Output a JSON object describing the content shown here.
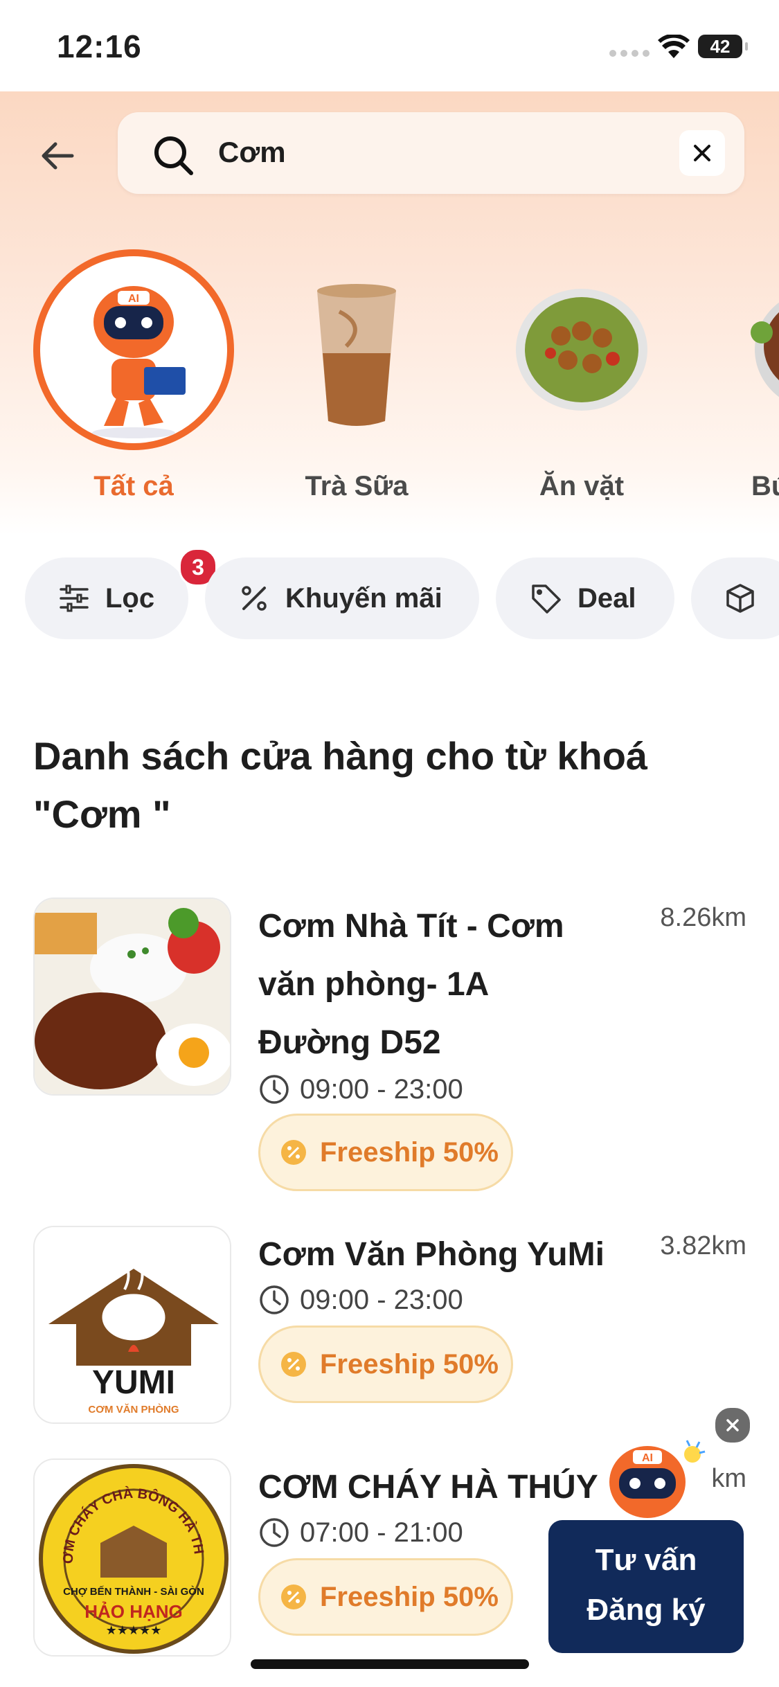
{
  "status_bar": {
    "time": "12:16",
    "battery": "42"
  },
  "search": {
    "query": "Cơm"
  },
  "categories": [
    {
      "label": "Tất cả",
      "icon": "ai-robot-icon",
      "active": true
    },
    {
      "label": "Trà Sữa",
      "icon": "milk-tea-icon",
      "active": false
    },
    {
      "label": "Ăn vặt",
      "icon": "snack-plate-icon",
      "active": false
    },
    {
      "label": "Bú",
      "icon": "noodle-bowl-icon",
      "active": false
    }
  ],
  "filters": [
    {
      "label": "Lọc",
      "icon": "sliders-icon",
      "badge": "3"
    },
    {
      "label": "Khuyến mãi",
      "icon": "percent-icon"
    },
    {
      "label": "Deal",
      "icon": "tag-icon"
    },
    {
      "label": "",
      "icon": "box-icon"
    }
  ],
  "section_title_line1": "Danh sách cửa hàng cho từ khoá",
  "section_title_line2": "\"Cơm \"",
  "stores": [
    {
      "name_lines": [
        "Cơm Nhà Tít - Cơm",
        "văn phòng- 1A",
        "Đường D52"
      ],
      "distance": "8.26km",
      "hours": "09:00 - 23:00",
      "promo": "Freeship 50%"
    },
    {
      "name_lines": [
        "Cơm Văn Phòng YuMi"
      ],
      "distance": "3.82km",
      "hours": "09:00 - 23:00",
      "promo": "Freeship 50%"
    },
    {
      "name_lines": [
        "CƠM CHÁY HÀ THÚY"
      ],
      "distance": "km",
      "hours": "07:00 - 21:00",
      "promo": "Freeship 50%"
    }
  ],
  "logos": {
    "yumi_brand": "YUMI",
    "yumi_sub": "CƠM VĂN PHÒNG",
    "hathuy_arc": "CƠM CHÁY CHÀ BÔNG HÀ THÚY",
    "hathuy_line": "CHỢ BẾN THÀNH - SÀI GÒN",
    "hathuy_grade": "HẢO HẠNG",
    "ai_tag": "AI"
  },
  "ai_widget": {
    "line1": "Tư vấn",
    "line2": "Đăng ký"
  },
  "colors": {
    "accent": "#f2692a",
    "promo_text": "#e07b2a",
    "widget_bg": "#112a5a",
    "badge": "#d9263a"
  }
}
